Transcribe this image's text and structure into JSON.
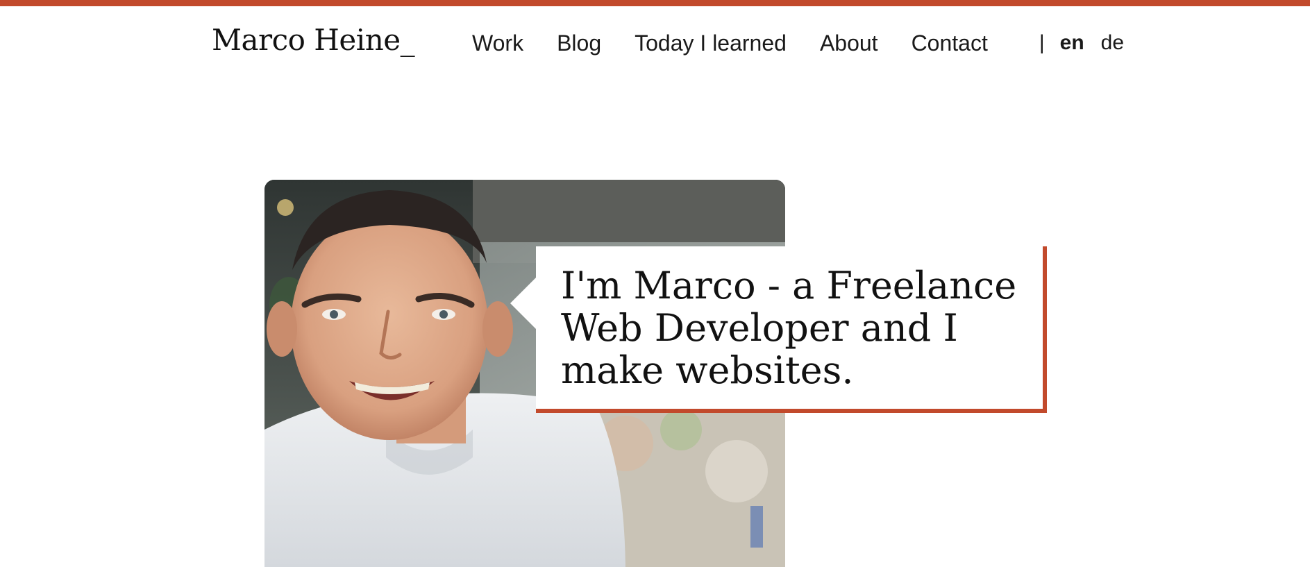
{
  "brand": {
    "accent_color": "#c24a2c",
    "logo_text": "Marco Heine_"
  },
  "nav": {
    "links": [
      "Work",
      "Blog",
      "Today I learned",
      "About",
      "Contact"
    ],
    "separator": "|",
    "languages": {
      "active": "en",
      "other": "de"
    }
  },
  "hero": {
    "photo_icon": "portrait-photo",
    "headline": "I'm Marco - a Freelance Web Developer and I make websites."
  }
}
